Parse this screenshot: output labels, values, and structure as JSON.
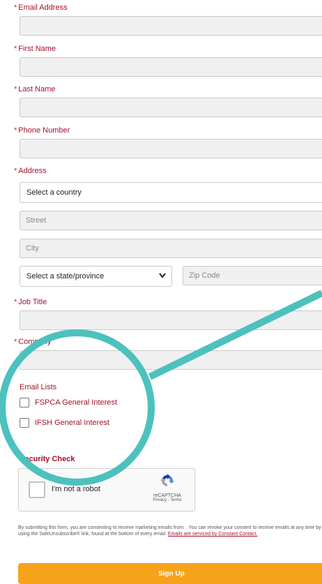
{
  "fields": {
    "email_label": "Email Address",
    "first_label": "First Name",
    "last_label": "Last Name",
    "phone_label": "Phone Number",
    "address_label": "Address",
    "job_label": "Job Title",
    "company_label": "Company",
    "required_marker": "*"
  },
  "address": {
    "country_select": "Select a country",
    "street_placeholder": "Street",
    "city_placeholder": "City",
    "state_select": "Select a state/province",
    "zip_placeholder": "Zip Code"
  },
  "email_lists": {
    "title": "Email Lists",
    "items": [
      {
        "label": "FSPCA General Interest"
      },
      {
        "label": "IFSH General Interest"
      }
    ]
  },
  "security": {
    "title": "Security Check",
    "captcha_text": "I'm not a robot",
    "captcha_brand": "reCAPTCHA",
    "captcha_links": "Privacy - Terms"
  },
  "legal": {
    "text": "By submitting this form, you are consenting to receive marketing emails from: . You can revoke your consent to receive emails at any time by using the SafeUnsubscribe® link, found at the bottom of every email.",
    "link_text": "Emails are serviced by Constant Contact."
  },
  "button": {
    "signup_label": "Sign Up"
  },
  "colors": {
    "label": "#a4112d",
    "button": "#f6a31a",
    "overlay": "#4cc1be"
  }
}
